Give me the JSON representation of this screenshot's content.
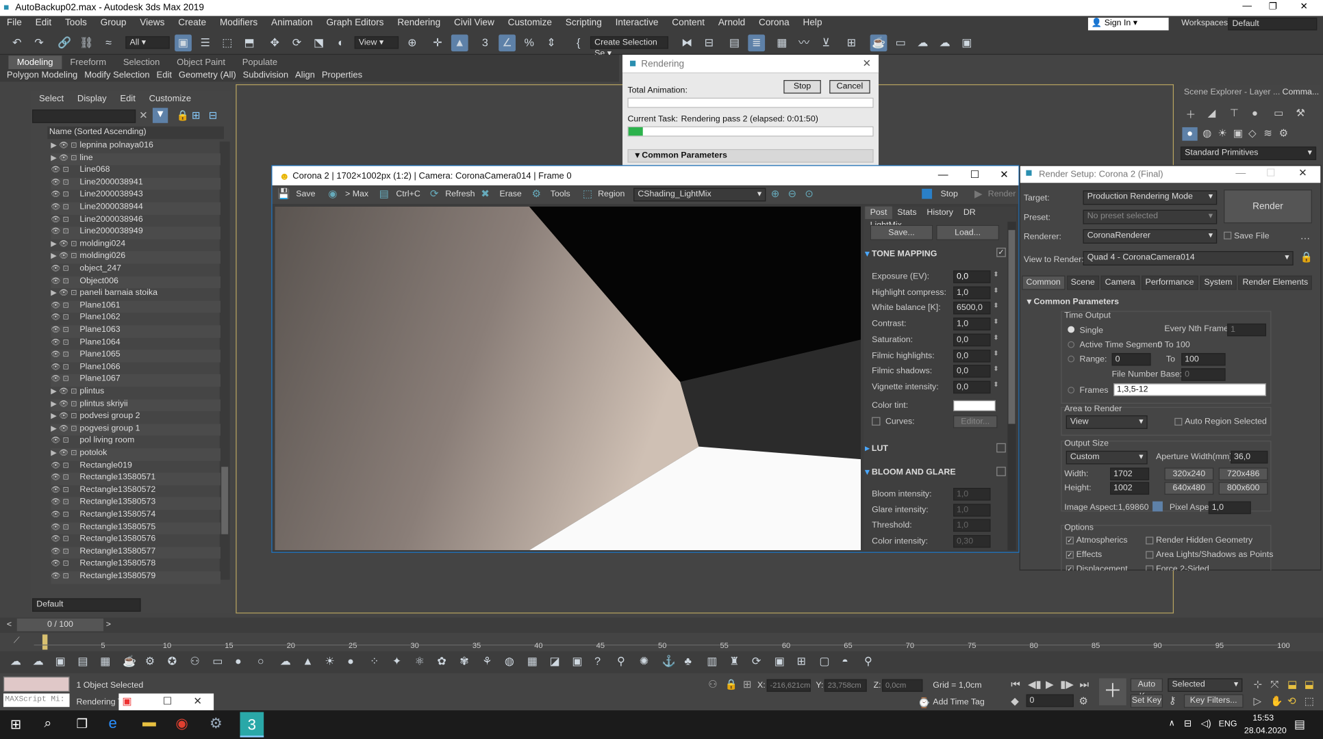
{
  "window": {
    "title": "AutoBackup02.max - Autodesk 3ds Max 2019"
  },
  "menu": [
    "File",
    "Edit",
    "Tools",
    "Group",
    "Views",
    "Create",
    "Modifiers",
    "Animation",
    "Graph Editors",
    "Rendering",
    "Civil View",
    "Customize",
    "Scripting",
    "Interactive",
    "Content",
    "Arnold",
    "Corona",
    "Help"
  ],
  "account": {
    "sign_in": "Sign In",
    "workspaces_label": "Workspaces:",
    "workspace": "Default"
  },
  "toolbar": {
    "filter": "All",
    "view": "View",
    "selection_set": "Create Selection Se"
  },
  "ribbon": {
    "tabs": [
      "Modeling",
      "Freeform",
      "Selection",
      "Object Paint",
      "Populate"
    ],
    "sub": [
      "Polygon Modeling",
      "Modify Selection",
      "Edit",
      "Geometry (All)",
      "Subdivision",
      "Align",
      "Properties"
    ]
  },
  "scene_explorer": {
    "tabs": [
      "Select",
      "Display",
      "Edit",
      "Customize"
    ],
    "column": "Name (Sorted Ascending)",
    "rows": [
      "lepnina polnaya016",
      "line",
      "Line068",
      "Line2000038941",
      "Line2000038943",
      "Line2000038944",
      "Line2000038946",
      "Line2000038949",
      "moldingi024",
      "moldingi026",
      "object_247",
      "Object006",
      "paneli barnaia stoika",
      "Plane1061",
      "Plane1062",
      "Plane1063",
      "Plane1064",
      "Plane1065",
      "Plane1066",
      "Plane1067",
      "plintus",
      "plintus skriyii",
      "podvesi group 2",
      "pogvesi group 1",
      "pol living room",
      "potolok",
      "Rectangle019",
      "Rectangle13580571",
      "Rectangle13580572",
      "Rectangle13580573",
      "Rectangle13580574",
      "Rectangle13580575",
      "Rectangle13580576",
      "Rectangle13580577",
      "Rectangle13580578",
      "Rectangle13580579"
    ],
    "layer": "Default"
  },
  "rendering": {
    "title": "Rendering",
    "total": "Total Animation:",
    "stop": "Stop",
    "cancel": "Cancel",
    "current_task_label": "Current Task:",
    "current_task": "Rendering pass 2 (elapsed: 0:01:50)",
    "progress": 0.06,
    "common": "Common Parameters"
  },
  "vfb": {
    "title": "Corona 2 | 1702×1002px (1:2) | Camera: CoronaCamera014 | Frame 0",
    "save": "Save",
    "to_max": "> Max",
    "ctrlc": "Ctrl+C",
    "refresh": "Refresh",
    "erase": "Erase",
    "tools": "Tools",
    "region": "Region",
    "channel": "CShading_LightMix",
    "stop": "Stop",
    "render": "Render",
    "tabs": [
      "Post",
      "Stats",
      "History",
      "DR",
      "LightMix"
    ],
    "save_btn": "Save...",
    "load_btn": "Load...",
    "tone_mapping": "TONE MAPPING",
    "params": [
      {
        "label": "Exposure (EV):",
        "value": "0,0"
      },
      {
        "label": "Highlight compress:",
        "value": "1,0"
      },
      {
        "label": "White balance [K]:",
        "value": "6500,0"
      },
      {
        "label": "Contrast:",
        "value": "1,0"
      },
      {
        "label": "Saturation:",
        "value": "0,0"
      },
      {
        "label": "Filmic highlights:",
        "value": "0,0"
      },
      {
        "label": "Filmic shadows:",
        "value": "0,0"
      },
      {
        "label": "Vignette intensity:",
        "value": "0,0"
      }
    ],
    "color_tint": "Color tint:",
    "curves": "Curves:",
    "editor": "Editor...",
    "lut": "LUT",
    "bloom": "BLOOM AND GLARE",
    "bloom_params": [
      {
        "label": "Bloom intensity:",
        "value": "1,0"
      },
      {
        "label": "Glare intensity:",
        "value": "1,0"
      },
      {
        "label": "Threshold:",
        "value": "1,0"
      },
      {
        "label": "Color intensity:",
        "value": "0,30"
      }
    ]
  },
  "render_setup": {
    "title": "Render Setup: Corona 2 (Final)",
    "target_label": "Target:",
    "target": "Production Rendering Mode",
    "preset_label": "Preset:",
    "preset": "No preset selected",
    "renderer_label": "Renderer:",
    "renderer": "CoronaRenderer",
    "save_file": "Save File",
    "view_label": "View to Render:",
    "view": "Quad 4 - CoronaCamera014",
    "render": "Render",
    "tabs": [
      "Common",
      "Scene",
      "Camera",
      "Performance",
      "System",
      "Render Elements"
    ],
    "common_params": "Common Parameters",
    "time_output": "Time Output",
    "single": "Single",
    "every_nth": "Every Nth Frame:",
    "every_nth_val": "1",
    "active_segment": "Active Time Segment:",
    "segment_val": "0 To 100",
    "range": "Range:",
    "range_from": "0",
    "to": "To",
    "range_to": "100",
    "file_base": "File Number Base:",
    "file_base_val": "0",
    "frames": "Frames",
    "frames_val": "1,3,5-12",
    "area": "Area to Render",
    "area_val": "View",
    "auto_region": "Auto Region Selected",
    "output_size": "Output Size",
    "size_preset": "Custom",
    "aperture": "Aperture Width(mm):",
    "aperture_val": "36,0",
    "width": "Width:",
    "width_val": "1702",
    "height": "Height:",
    "height_val": "1002",
    "presets": [
      "320x240",
      "720x486",
      "640x480",
      "800x600"
    ],
    "image_aspect": "Image Aspect:1,69860",
    "pixel_aspect": "Pixel Aspect:",
    "pixel_aspect_val": "1,0",
    "options": "Options",
    "opts": [
      "Atmospherics",
      "Render Hidden Geometry",
      "Effects",
      "Area Lights/Shadows as Points",
      "Displacement",
      "Force 2-Sided"
    ]
  },
  "command_panel": {
    "scene_explorer": "Scene Explorer - Layer ...",
    "comma": "Comma...",
    "primitives": "Standard Primitives"
  },
  "timeline": {
    "frame": "0 / 100",
    "ticks": [
      "5",
      "10",
      "15",
      "20",
      "25",
      "30",
      "35",
      "40",
      "45",
      "50",
      "55",
      "60",
      "65",
      "70",
      "75",
      "80",
      "85",
      "90",
      "95",
      "100"
    ]
  },
  "status": {
    "maxscript": "MAXScript Mi:",
    "selected": "1 Object Selected",
    "rendering": "Rendering T",
    "x_label": "X:",
    "x": "-216,621cm",
    "y_label": "Y:",
    "y": "23,758cm",
    "z_label": "Z:",
    "z": "0,0cm",
    "grid": "Grid = 1,0cm",
    "add_time_tag": "Add Time Tag",
    "auto_key": "Auto Key",
    "set_key": "Set Key",
    "selected_dd": "Selected",
    "key_filters": "Key Filters...",
    "frame_field": "0"
  },
  "taskbar": {
    "lang": "ENG",
    "time": "15:53",
    "date": "28.04.2020"
  }
}
